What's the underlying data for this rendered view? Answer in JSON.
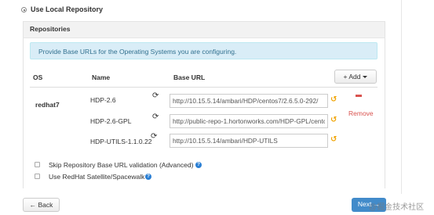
{
  "repo_option": {
    "label": "Use Local Repository"
  },
  "panel": {
    "title": "Repositories"
  },
  "info_message": "Provide Base URLs for the Operating Systems you are configuring.",
  "table": {
    "headers": {
      "os": "OS",
      "name": "Name",
      "base_url": "Base URL"
    },
    "add_button": "+ Add",
    "os": "redhat7",
    "remove_label": "Remove",
    "rows": [
      {
        "name": "HDP-2.6",
        "base_url": "http://10.15.5.14/ambari/HDP/centos7/2.6.5.0-292/"
      },
      {
        "name": "HDP-2.6-GPL",
        "base_url": "http://public-repo-1.hortonworks.com/HDP-GPL/centos7/2.x/updates/2.6.5.0"
      },
      {
        "name": "HDP-UTILS-1.1.0.22",
        "base_url": "http://10.15.5.14/ambari/HDP-UTILS"
      }
    ]
  },
  "options": {
    "skip_validation": "Skip Repository Base URL validation (Advanced)",
    "redhat_satellite": "Use RedHat Satellite/Spacewalk"
  },
  "footer": {
    "back_label": "← Back",
    "next_label": "Next →",
    "watermark": "@掘金技术社区"
  },
  "colors": {
    "info_bg": "#d9edf7",
    "info_text": "#31708f",
    "remove": "#d9534f",
    "undo": "#f0a300",
    "primary": "#428bca",
    "help": "#2a7fd4"
  },
  "icons": {
    "refresh": "refresh-icon",
    "undo": "undo-icon",
    "remove": "minus-icon",
    "help": "question-circle-icon",
    "caret": "caret-down-icon"
  }
}
